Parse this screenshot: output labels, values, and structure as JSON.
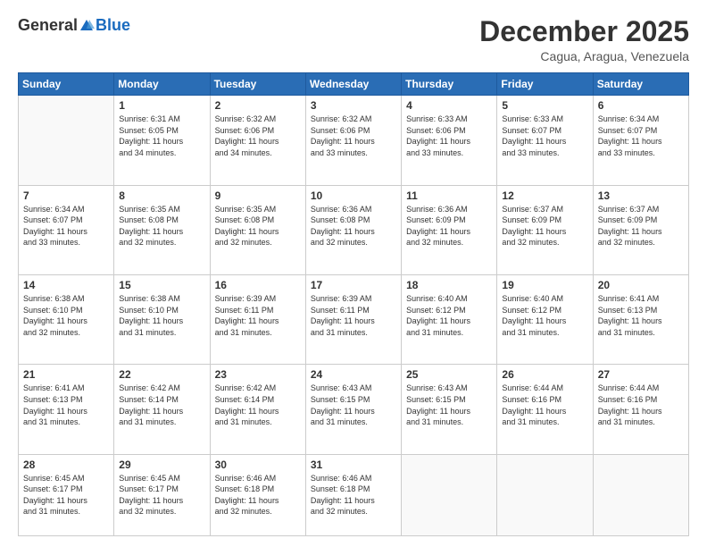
{
  "header": {
    "logo": {
      "general": "General",
      "blue": "Blue"
    },
    "title": "December 2025",
    "location": "Cagua, Aragua, Venezuela"
  },
  "calendar": {
    "days_of_week": [
      "Sunday",
      "Monday",
      "Tuesday",
      "Wednesday",
      "Thursday",
      "Friday",
      "Saturday"
    ],
    "weeks": [
      [
        {
          "day": "",
          "info": ""
        },
        {
          "day": "1",
          "info": "Sunrise: 6:31 AM\nSunset: 6:05 PM\nDaylight: 11 hours\nand 34 minutes."
        },
        {
          "day": "2",
          "info": "Sunrise: 6:32 AM\nSunset: 6:06 PM\nDaylight: 11 hours\nand 34 minutes."
        },
        {
          "day": "3",
          "info": "Sunrise: 6:32 AM\nSunset: 6:06 PM\nDaylight: 11 hours\nand 33 minutes."
        },
        {
          "day": "4",
          "info": "Sunrise: 6:33 AM\nSunset: 6:06 PM\nDaylight: 11 hours\nand 33 minutes."
        },
        {
          "day": "5",
          "info": "Sunrise: 6:33 AM\nSunset: 6:07 PM\nDaylight: 11 hours\nand 33 minutes."
        },
        {
          "day": "6",
          "info": "Sunrise: 6:34 AM\nSunset: 6:07 PM\nDaylight: 11 hours\nand 33 minutes."
        }
      ],
      [
        {
          "day": "7",
          "info": "Sunrise: 6:34 AM\nSunset: 6:07 PM\nDaylight: 11 hours\nand 33 minutes."
        },
        {
          "day": "8",
          "info": "Sunrise: 6:35 AM\nSunset: 6:08 PM\nDaylight: 11 hours\nand 32 minutes."
        },
        {
          "day": "9",
          "info": "Sunrise: 6:35 AM\nSunset: 6:08 PM\nDaylight: 11 hours\nand 32 minutes."
        },
        {
          "day": "10",
          "info": "Sunrise: 6:36 AM\nSunset: 6:08 PM\nDaylight: 11 hours\nand 32 minutes."
        },
        {
          "day": "11",
          "info": "Sunrise: 6:36 AM\nSunset: 6:09 PM\nDaylight: 11 hours\nand 32 minutes."
        },
        {
          "day": "12",
          "info": "Sunrise: 6:37 AM\nSunset: 6:09 PM\nDaylight: 11 hours\nand 32 minutes."
        },
        {
          "day": "13",
          "info": "Sunrise: 6:37 AM\nSunset: 6:09 PM\nDaylight: 11 hours\nand 32 minutes."
        }
      ],
      [
        {
          "day": "14",
          "info": "Sunrise: 6:38 AM\nSunset: 6:10 PM\nDaylight: 11 hours\nand 32 minutes."
        },
        {
          "day": "15",
          "info": "Sunrise: 6:38 AM\nSunset: 6:10 PM\nDaylight: 11 hours\nand 31 minutes."
        },
        {
          "day": "16",
          "info": "Sunrise: 6:39 AM\nSunset: 6:11 PM\nDaylight: 11 hours\nand 31 minutes."
        },
        {
          "day": "17",
          "info": "Sunrise: 6:39 AM\nSunset: 6:11 PM\nDaylight: 11 hours\nand 31 minutes."
        },
        {
          "day": "18",
          "info": "Sunrise: 6:40 AM\nSunset: 6:12 PM\nDaylight: 11 hours\nand 31 minutes."
        },
        {
          "day": "19",
          "info": "Sunrise: 6:40 AM\nSunset: 6:12 PM\nDaylight: 11 hours\nand 31 minutes."
        },
        {
          "day": "20",
          "info": "Sunrise: 6:41 AM\nSunset: 6:13 PM\nDaylight: 11 hours\nand 31 minutes."
        }
      ],
      [
        {
          "day": "21",
          "info": "Sunrise: 6:41 AM\nSunset: 6:13 PM\nDaylight: 11 hours\nand 31 minutes."
        },
        {
          "day": "22",
          "info": "Sunrise: 6:42 AM\nSunset: 6:14 PM\nDaylight: 11 hours\nand 31 minutes."
        },
        {
          "day": "23",
          "info": "Sunrise: 6:42 AM\nSunset: 6:14 PM\nDaylight: 11 hours\nand 31 minutes."
        },
        {
          "day": "24",
          "info": "Sunrise: 6:43 AM\nSunset: 6:15 PM\nDaylight: 11 hours\nand 31 minutes."
        },
        {
          "day": "25",
          "info": "Sunrise: 6:43 AM\nSunset: 6:15 PM\nDaylight: 11 hours\nand 31 minutes."
        },
        {
          "day": "26",
          "info": "Sunrise: 6:44 AM\nSunset: 6:16 PM\nDaylight: 11 hours\nand 31 minutes."
        },
        {
          "day": "27",
          "info": "Sunrise: 6:44 AM\nSunset: 6:16 PM\nDaylight: 11 hours\nand 31 minutes."
        }
      ],
      [
        {
          "day": "28",
          "info": "Sunrise: 6:45 AM\nSunset: 6:17 PM\nDaylight: 11 hours\nand 31 minutes."
        },
        {
          "day": "29",
          "info": "Sunrise: 6:45 AM\nSunset: 6:17 PM\nDaylight: 11 hours\nand 32 minutes."
        },
        {
          "day": "30",
          "info": "Sunrise: 6:46 AM\nSunset: 6:18 PM\nDaylight: 11 hours\nand 32 minutes."
        },
        {
          "day": "31",
          "info": "Sunrise: 6:46 AM\nSunset: 6:18 PM\nDaylight: 11 hours\nand 32 minutes."
        },
        {
          "day": "",
          "info": ""
        },
        {
          "day": "",
          "info": ""
        },
        {
          "day": "",
          "info": ""
        }
      ]
    ]
  }
}
